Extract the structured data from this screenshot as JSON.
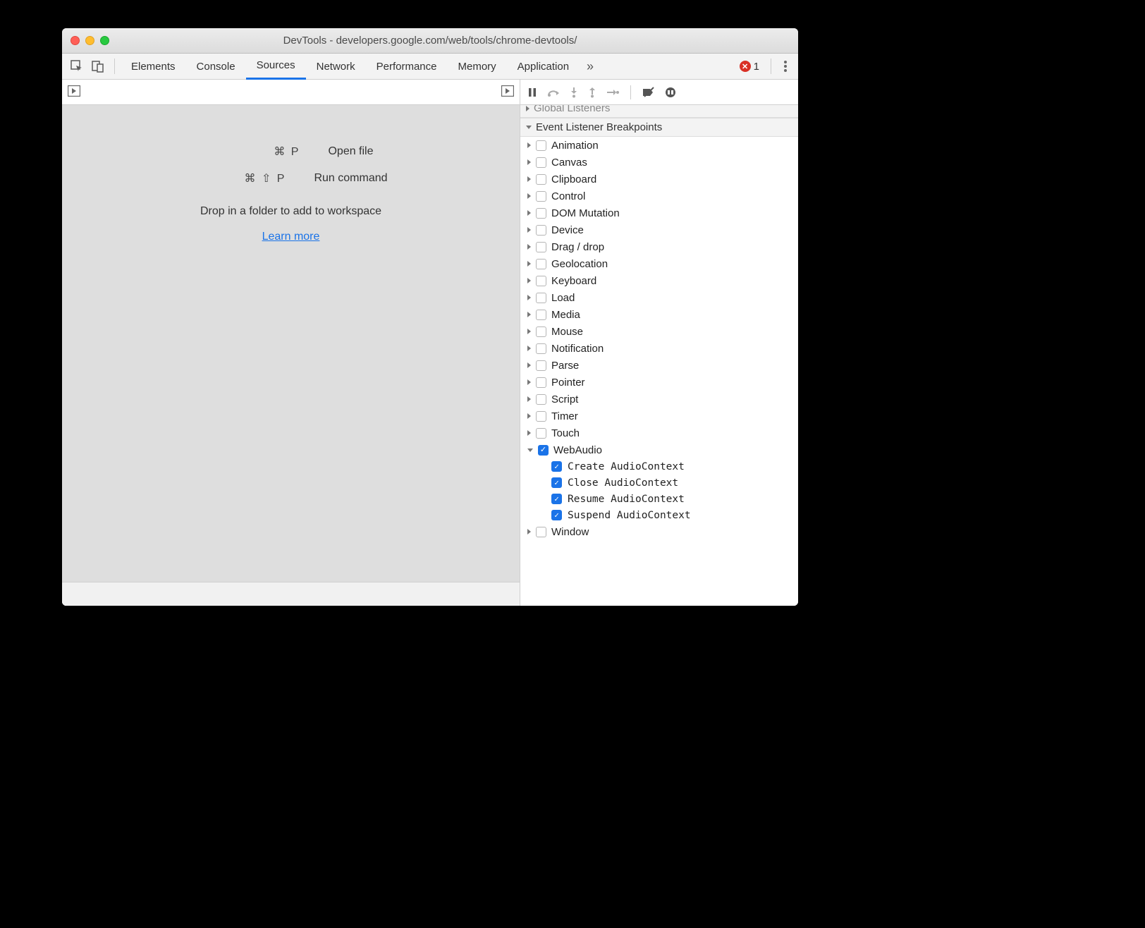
{
  "window": {
    "title": "DevTools - developers.google.com/web/tools/chrome-devtools/"
  },
  "tabs": {
    "items": [
      "Elements",
      "Console",
      "Sources",
      "Network",
      "Performance",
      "Memory",
      "Application"
    ],
    "active": "Sources",
    "error_count": "1"
  },
  "sources_placeholder": {
    "open_keys": "⌘ P",
    "open_label": "Open file",
    "run_keys": "⌘ ⇧ P",
    "run_label": "Run command",
    "drop_text": "Drop in a folder to add to workspace",
    "learn_more": "Learn more"
  },
  "sidebar": {
    "global_listeners": "Global Listeners",
    "breakpoints_header": "Event Listener Breakpoints",
    "categories": [
      {
        "label": "Animation",
        "expanded": false,
        "checked": false
      },
      {
        "label": "Canvas",
        "expanded": false,
        "checked": false
      },
      {
        "label": "Clipboard",
        "expanded": false,
        "checked": false
      },
      {
        "label": "Control",
        "expanded": false,
        "checked": false
      },
      {
        "label": "DOM Mutation",
        "expanded": false,
        "checked": false
      },
      {
        "label": "Device",
        "expanded": false,
        "checked": false
      },
      {
        "label": "Drag / drop",
        "expanded": false,
        "checked": false
      },
      {
        "label": "Geolocation",
        "expanded": false,
        "checked": false
      },
      {
        "label": "Keyboard",
        "expanded": false,
        "checked": false
      },
      {
        "label": "Load",
        "expanded": false,
        "checked": false
      },
      {
        "label": "Media",
        "expanded": false,
        "checked": false
      },
      {
        "label": "Mouse",
        "expanded": false,
        "checked": false
      },
      {
        "label": "Notification",
        "expanded": false,
        "checked": false
      },
      {
        "label": "Parse",
        "expanded": false,
        "checked": false
      },
      {
        "label": "Pointer",
        "expanded": false,
        "checked": false
      },
      {
        "label": "Script",
        "expanded": false,
        "checked": false
      },
      {
        "label": "Timer",
        "expanded": false,
        "checked": false
      },
      {
        "label": "Touch",
        "expanded": false,
        "checked": false
      },
      {
        "label": "WebAudio",
        "expanded": true,
        "checked": true,
        "children": [
          {
            "label": "Create AudioContext",
            "checked": true
          },
          {
            "label": "Close AudioContext",
            "checked": true
          },
          {
            "label": "Resume AudioContext",
            "checked": true
          },
          {
            "label": "Suspend AudioContext",
            "checked": true
          }
        ]
      },
      {
        "label": "Window",
        "expanded": false,
        "checked": false
      }
    ]
  }
}
